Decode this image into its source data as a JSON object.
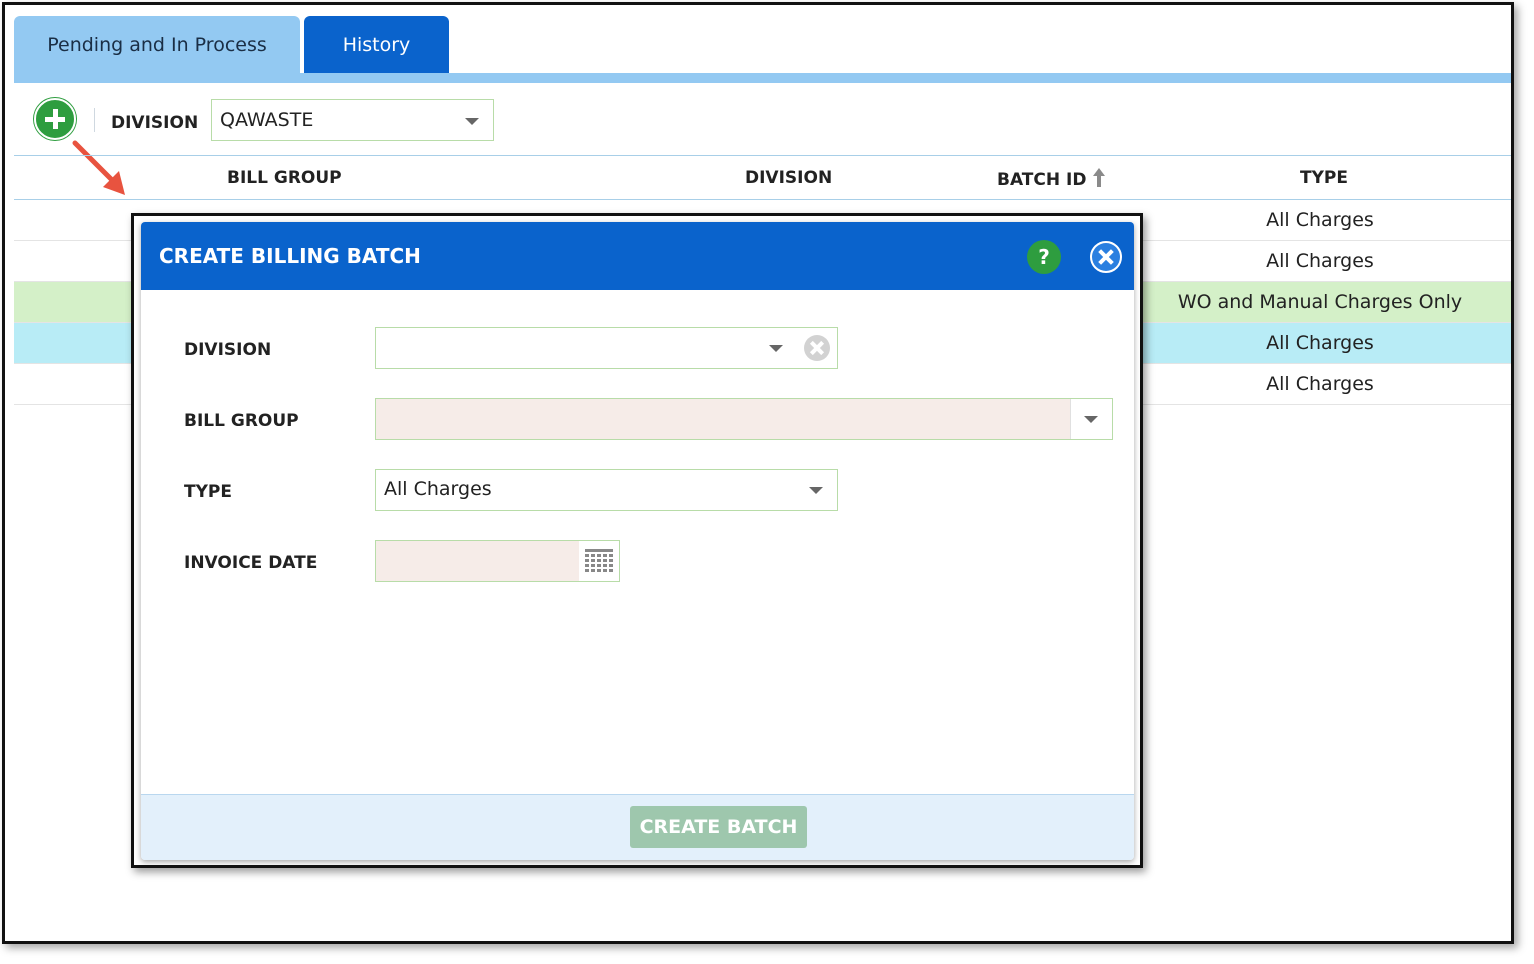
{
  "tabs": [
    {
      "label": "Pending and In Process"
    },
    {
      "label": "History"
    }
  ],
  "toolbar": {
    "division_label": "DIVISION",
    "division_value": "QAWASTE"
  },
  "grid": {
    "columns": {
      "bill_group": "BILL GROUP",
      "division": "DIVISION",
      "batch_id": "BATCH ID",
      "type": "TYPE"
    },
    "rows": [
      {
        "type": "All Charges"
      },
      {
        "type": "All Charges"
      },
      {
        "type": "WO and Manual Charges Only"
      },
      {
        "type": "All Charges"
      },
      {
        "type": "All Charges"
      }
    ]
  },
  "modal": {
    "title": "CREATE BILLING BATCH",
    "help_symbol": "?",
    "fields": {
      "division_label": "DIVISION",
      "division_value": "",
      "bill_group_label": "BILL GROUP",
      "bill_group_value": "",
      "type_label": "TYPE",
      "type_value": "All Charges",
      "invoice_date_label": "INVOICE DATE",
      "invoice_date_value": ""
    },
    "create_button": "CREATE BATCH"
  },
  "colors": {
    "brand_blue": "#0a63cc",
    "tab_light_blue": "#93c9f2",
    "add_green": "#2e9d3f",
    "row_highlight_green": "#d4f0c8",
    "row_highlight_cyan": "#b8ecf6",
    "annotation_arrow": "#e8533f"
  }
}
